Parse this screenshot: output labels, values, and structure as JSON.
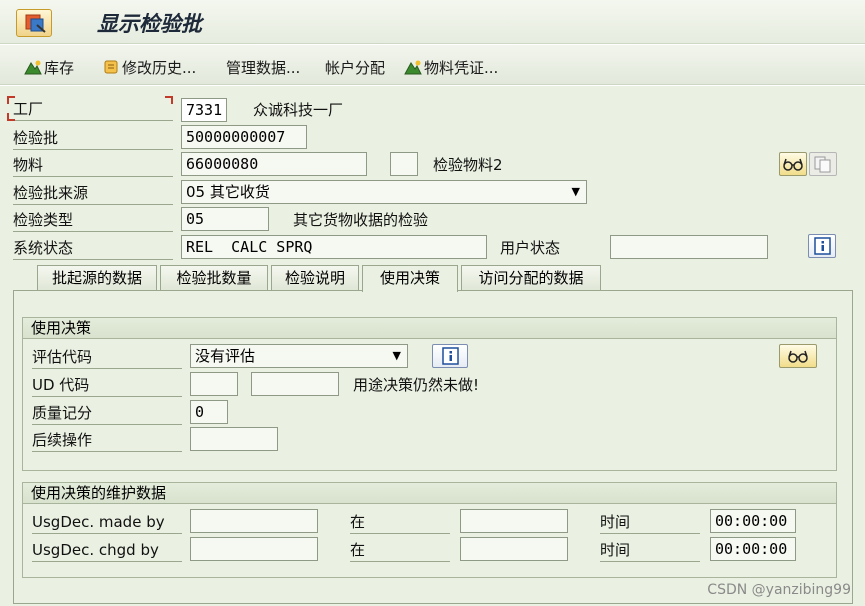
{
  "window": {
    "title": "显示检验批"
  },
  "toolbar": {
    "items": [
      {
        "label": "库存",
        "icon": "mountain-icon"
      },
      {
        "label": "修改历史...",
        "icon": "scroll-icon"
      },
      {
        "label": "管理数据...",
        "icon": ""
      },
      {
        "label": "帐户分配",
        "icon": ""
      },
      {
        "label": "物料凭证...",
        "icon": "mountain-icon"
      }
    ]
  },
  "header": {
    "plant_label": "工厂",
    "plant_value": "7331",
    "plant_name": "众诚科技一厂",
    "lot_label": "检验批",
    "lot_value": "50000000007",
    "material_label": "物料",
    "material_value": "66000080",
    "material_extra": "",
    "insp_material_label": "检验物料2",
    "origin_label": "检验批来源",
    "origin_value": "05 其它收货",
    "type_label": "检验类型",
    "type_value": "05",
    "type_desc": "其它货物收据的检验",
    "sys_status_label": "系统状态",
    "sys_status_value": "REL  CALC SPRQ",
    "user_status_label": "用户状态",
    "user_status_value": ""
  },
  "tabs": [
    {
      "label": "批起源的数据"
    },
    {
      "label": "检验批数量"
    },
    {
      "label": "检验说明"
    },
    {
      "label": "使用决策"
    },
    {
      "label": "访问分配的数据"
    }
  ],
  "decision": {
    "group_title": "使用决策",
    "valuation_label": "评估代码",
    "valuation_value": "没有评估",
    "ud_code_label": "UD 代码",
    "ud_code_group": "",
    "ud_code_value": "",
    "ud_message": "用途决策仍然未做!",
    "quality_score_label": "质量记分",
    "quality_score_value": "0",
    "follow_up_label": "后续操作",
    "follow_up_value": ""
  },
  "maintenance": {
    "group_title": "使用决策的维护数据",
    "made_by_label": "UsgDec. made by",
    "changed_by_label": "UsgDec. chgd by",
    "at_label": "在",
    "time_label": "时间",
    "made_by_value": "",
    "made_on_value": "",
    "made_time_value": "00:00:00",
    "changed_by_value": "",
    "changed_on_value": "",
    "changed_time_value": "00:00:00"
  },
  "watermark": "CSDN @yanzibing99",
  "colors": {
    "accent": "#eaf1e2",
    "button_yellow": "#f1dd8a",
    "required": "#c23a2a"
  }
}
